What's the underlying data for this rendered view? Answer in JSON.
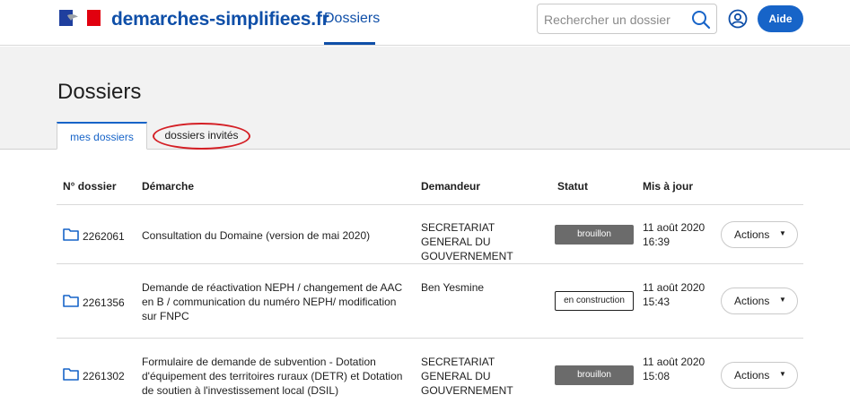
{
  "header": {
    "brand": "demarches-simplifiees.fr",
    "nav_link": "Dossiers",
    "search_placeholder": "Rechercher un dossier",
    "help_label": "Aide"
  },
  "page": {
    "title": "Dossiers",
    "tabs": [
      {
        "label": "mes dossiers",
        "active": true
      },
      {
        "label": "dossiers invités",
        "active": false,
        "highlighted": true
      }
    ]
  },
  "table": {
    "headers": {
      "number": "N° dossier",
      "procedure": "Démarche",
      "requester": "Demandeur",
      "status": "Statut",
      "updated": "Mis à jour"
    },
    "rows": [
      {
        "number": "2262061",
        "procedure": "Consultation du Domaine (version de mai 2020)",
        "requester": "SECRETARIAT GENERAL DU GOUVERNEMENT",
        "status": "brouillon",
        "status_style": "filled",
        "date": "11 août 2020",
        "time": "16:39",
        "actions": "Actions"
      },
      {
        "number": "2261356",
        "procedure": "Demande de réactivation NEPH / changement de AAC en B / communication du numéro NEPH/ modification sur FNPC",
        "requester": "Ben Yesmine",
        "status": "en construction",
        "status_style": "outline",
        "date": "11 août 2020",
        "time": "15:43",
        "actions": "Actions"
      },
      {
        "number": "2261302",
        "procedure": "Formulaire de demande de subvention - Dotation d'équipement des territoires ruraux (DETR) et Dotation de soutien à l'investissement local (DSIL)",
        "requester": "SECRETARIAT GENERAL DU GOUVERNEMENT",
        "status": "brouillon",
        "status_style": "filled",
        "date": "11 août 2020",
        "time": "15:08",
        "actions": "Actions"
      }
    ]
  },
  "colors": {
    "brand_blue": "#0f4fa8",
    "button_blue": "#1764c8",
    "badge_grey": "#6b6b6b",
    "highlight_red": "#d41f25"
  }
}
